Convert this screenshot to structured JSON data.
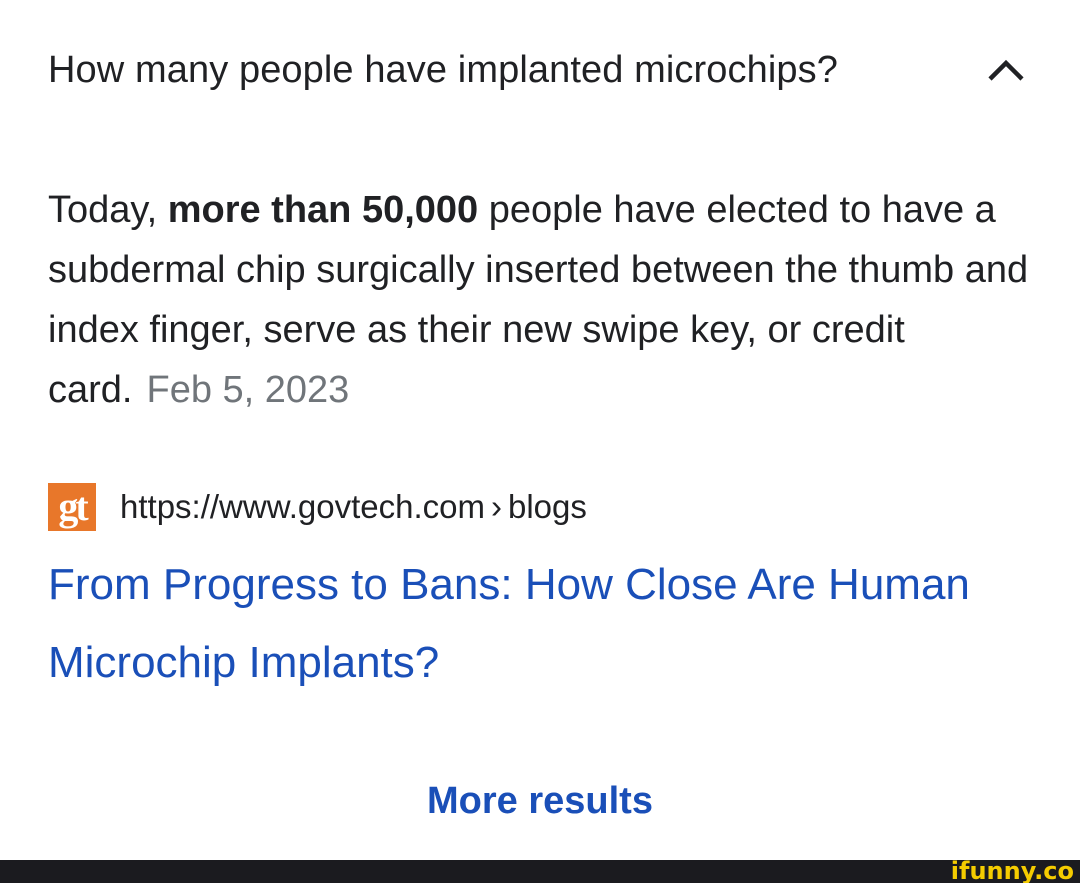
{
  "question": {
    "text": "How many people have implanted microchips?",
    "toggle_icon": "chevron-up-icon"
  },
  "answer": {
    "prefix": "Today, ",
    "bold": "more than 50,000",
    "suffix": " people have elected to have a subdermal chip surgically inserted between the thumb and index finger, serve as their new swipe key, or credit card.",
    "date": "Feb 5, 2023"
  },
  "source": {
    "favicon_text": "gt",
    "url": "https://www.govtech.com",
    "separator": "›",
    "path": "blogs"
  },
  "result": {
    "title": "From Progress to Bans: How Close Are Human Microchip Implants?"
  },
  "more_results": {
    "label": "More results"
  },
  "watermark": {
    "text": "ifunny.co"
  },
  "colors": {
    "text": "#202124",
    "date": "#70757a",
    "link": "#1a4fb8",
    "favicon_bg": "#e8772a",
    "footer_bg": "#1b1b1f",
    "watermark": "#f5cc00"
  }
}
